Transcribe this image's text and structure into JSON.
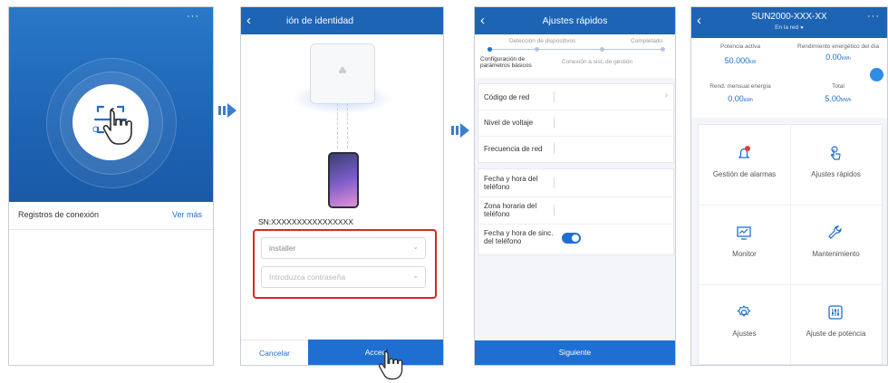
{
  "phone1": {
    "header_menu": "···",
    "history_label": "Registros de conexión",
    "history_more": "Ver más",
    "scan_label": "C"
  },
  "phone2": {
    "title": "ión de identidad",
    "sn": "SN:XXXXXXXXXXXXXXXX",
    "user_value": "installer",
    "password_placeholder": "Introduzca contraseña",
    "cancel_label": "Cancelar",
    "login_label": "Acced"
  },
  "phone3": {
    "title": "Ajustes rápidos",
    "steps": {
      "left_top": "Detección de dispositivos",
      "right_top": "Completado",
      "left_bottom": "Configuración de parámetros básicos",
      "right_bottom": "Conexión a sist. de gestión"
    },
    "rows": [
      {
        "label": "Código de red"
      },
      {
        "label": "Nivel de voltaje"
      },
      {
        "label": "Frecuencia de red"
      }
    ],
    "rows2": [
      {
        "label": "Fecha y hora del teléfono"
      },
      {
        "label": "Zona horaria del teléfono"
      },
      {
        "label": "Fecha y hora de sinc. del teléfono"
      }
    ],
    "next_label": "Siguiente"
  },
  "phone4": {
    "title": "SUN2000-XXX-XX",
    "status": "En la red ●",
    "menu": "···",
    "stats": [
      {
        "label": "Potencia activa",
        "value": "50.000",
        "unit": "kW"
      },
      {
        "label": "Rendimiento energético del día",
        "value": "0.00",
        "unit": "kWh"
      },
      {
        "label": "Rend. mensual energía",
        "value": "0.00",
        "unit": "kWh"
      },
      {
        "label": "Total",
        "value": "5.00",
        "unit": "MWh"
      }
    ],
    "menu_items": [
      {
        "label": "Gestión de alarmas",
        "icon": "alarm-icon"
      },
      {
        "label": "Ajustes rápidos",
        "icon": "touch-icon"
      },
      {
        "label": "Monitor",
        "icon": "monitor-icon"
      },
      {
        "label": "Mantenimiento",
        "icon": "wrench-icon"
      },
      {
        "label": "Ajustes",
        "icon": "gear-icon"
      },
      {
        "label": "Ajuste de potencia",
        "icon": "sliders-icon"
      }
    ]
  },
  "colors": {
    "primary": "#1e64b4",
    "accent": "#1e6fd1",
    "highlight": "#d62828",
    "alarm": "#e53935"
  }
}
